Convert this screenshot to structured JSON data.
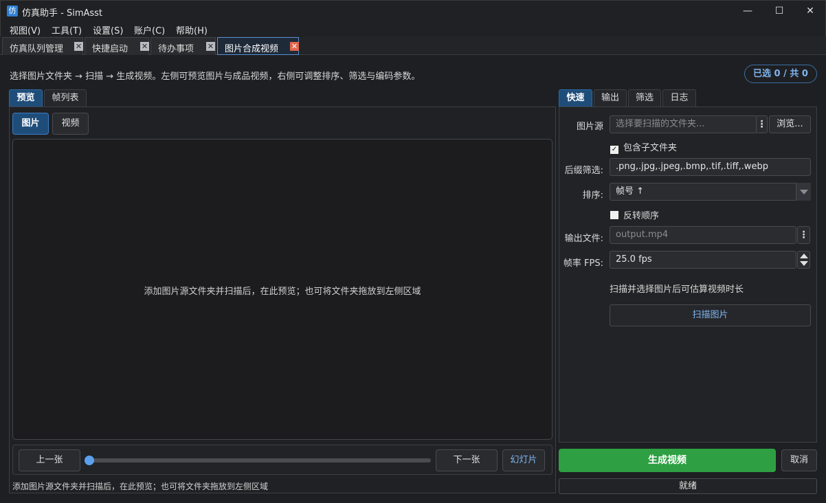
{
  "window": {
    "app_icon_glyph": "仿",
    "title": "仿真助手 - SimAsst",
    "minimize_glyph": "—",
    "maximize_glyph": "☐",
    "close_glyph": "✕"
  },
  "menubar": {
    "items": [
      {
        "label": "视图(V)"
      },
      {
        "label": "工具(T)"
      },
      {
        "label": "设置(S)"
      },
      {
        "label": "账户(C)"
      },
      {
        "label": "帮助(H)"
      }
    ]
  },
  "doc_tabs": [
    {
      "label": "仿真队列管理",
      "close": "✕"
    },
    {
      "label": "快捷启动",
      "close": "✕"
    },
    {
      "label": "待办事项",
      "close": "✕"
    },
    {
      "label": "图片合成视频",
      "close": "✕",
      "active": true
    }
  ],
  "hint": "选择图片文件夹 → 扫描 → 生成视频。左侧可预览图片与成品视频，右侧可调整排序、筛选与编码参数。",
  "counter_badge": "已选 0 / 共 0",
  "left": {
    "tabs": [
      {
        "label": "预览",
        "active": true
      },
      {
        "label": "帧列表"
      }
    ],
    "mode_buttons": [
      {
        "label": "图片",
        "active": true
      },
      {
        "label": "视频"
      }
    ],
    "preview_placeholder": "添加图片源文件夹并扫描后，在此预览；也可将文件夹拖放到左侧区域",
    "nav": {
      "prev": "上一张",
      "next": "下一张",
      "slideshow": "幻灯片",
      "slider_position": 0
    },
    "status": "添加图片源文件夹并扫描后，在此预览；也可将文件夹拖放到左侧区域"
  },
  "right": {
    "tabs": [
      {
        "label": "快速",
        "active": true
      },
      {
        "label": "输出"
      },
      {
        "label": "筛选"
      },
      {
        "label": "日志"
      }
    ],
    "source_label": "图片源",
    "source_placeholder": "选择要扫描的文件夹...",
    "browse": "浏览...",
    "include_subfolders": "包含子文件夹",
    "include_subfolders_checked": true,
    "suffix_label": "后缀筛选:",
    "suffix_value": ".png,.jpg,.jpeg,.bmp,.tif,.tiff,.webp",
    "sort_label": "排序:",
    "sort_value": "帧号 ↑",
    "reverse_label": "反转顺序",
    "reverse_checked": false,
    "output_label": "输出文件:",
    "output_placeholder": "output.mp4",
    "fps_label": "帧率 FPS:",
    "fps_value": "25.0 fps",
    "estimate": "扫描并选择图片后可估算视频时长",
    "scan_button": "扫描图片"
  },
  "footer": {
    "generate": "生成视频",
    "cancel": "取消",
    "status": "就绪"
  },
  "colors": {
    "accent_blue": "#1f4d7a",
    "link_blue": "#7fb5f0",
    "generate_green": "#2ea043",
    "active_tab_close": "#e0664d"
  }
}
